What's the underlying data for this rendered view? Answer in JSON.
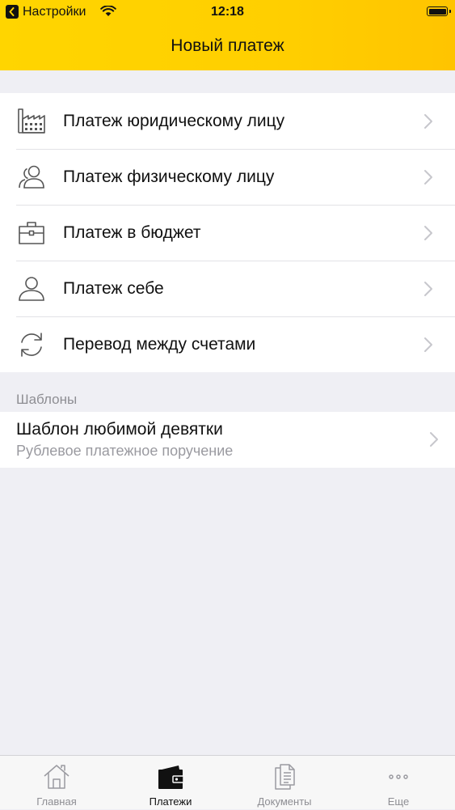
{
  "status_bar": {
    "back_app": "Настройки",
    "time": "12:18"
  },
  "nav": {
    "title": "Новый платеж"
  },
  "menu": {
    "items": [
      {
        "label": "Платеж юридическому лицу",
        "icon": "factory-icon"
      },
      {
        "label": "Платеж физическому лицу",
        "icon": "users-icon"
      },
      {
        "label": "Платеж в бюджет",
        "icon": "briefcase-icon"
      },
      {
        "label": "Платеж себе",
        "icon": "person-icon"
      },
      {
        "label": "Перевод между счетами",
        "icon": "refresh-icon"
      }
    ]
  },
  "templates": {
    "header": "Шаблоны",
    "items": [
      {
        "title": "Шаблон любимой девятки",
        "subtitle": "Рублевое платежное поручение"
      }
    ]
  },
  "tab_bar": {
    "tabs": [
      {
        "label": "Главная",
        "icon": "home-icon",
        "active": false
      },
      {
        "label": "Платежи",
        "icon": "wallet-icon",
        "active": true
      },
      {
        "label": "Документы",
        "icon": "documents-icon",
        "active": false
      },
      {
        "label": "Еще",
        "icon": "more-icon",
        "active": false
      }
    ]
  },
  "colors": {
    "header_accent": "#ffd200",
    "background": "#efeff4"
  }
}
